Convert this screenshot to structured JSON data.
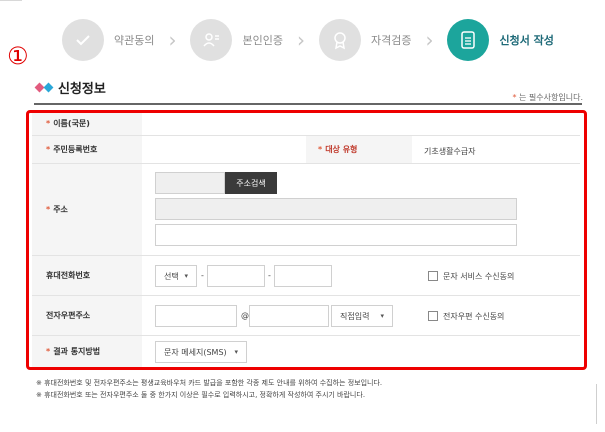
{
  "steps": [
    {
      "label": "약관동의",
      "active": false,
      "icon": "check-icon"
    },
    {
      "label": "본인인증",
      "active": false,
      "icon": "person-verify-icon"
    },
    {
      "label": "자격검증",
      "active": false,
      "icon": "badge-icon"
    },
    {
      "label": "신청서 작성",
      "active": true,
      "icon": "document-icon"
    }
  ],
  "step_separator": "›",
  "annotation_marker": "①",
  "section": {
    "title": "신청정보",
    "required_note": "는 필수사항입니다.",
    "required_mark": "*"
  },
  "form": {
    "name_label": "이름(국문)",
    "rrn_label": "주민등록번호",
    "target_type_label": "대상 유형",
    "target_type_value": "기초생활수급자",
    "address_label": "주소",
    "address_search_button": "주소검색",
    "mobile_label": "휴대전화번호",
    "mobile_prefix_select": "선택",
    "dash": "-",
    "sms_consent_label": "문자 서비스 수신동의",
    "email_label": "전자우편주소",
    "at_sign": "@",
    "email_domain_select": "직접입력",
    "email_consent_label": "전자우편 수신동의",
    "notify_label": "결과 통지방법",
    "notify_select": "문자 메세지(SMS)"
  },
  "notes": [
    "※ 휴대전화번호 및 전자우편주소는 평생교육바우처 카드 발급을 포함한 각종 제도 안내를 위하여 수집하는 정보입니다.",
    "※ 휴대전화번호 또는 전자우편주소 둘 중 한가지 이상은 필수로 입력하시고, 정확하게 작성하여 주시기 바랍니다."
  ],
  "colors": {
    "active_step": "#1ca59c",
    "inactive_step": "#e0e0e0",
    "highlight": "#ee0000",
    "required": "#e05a3a"
  }
}
